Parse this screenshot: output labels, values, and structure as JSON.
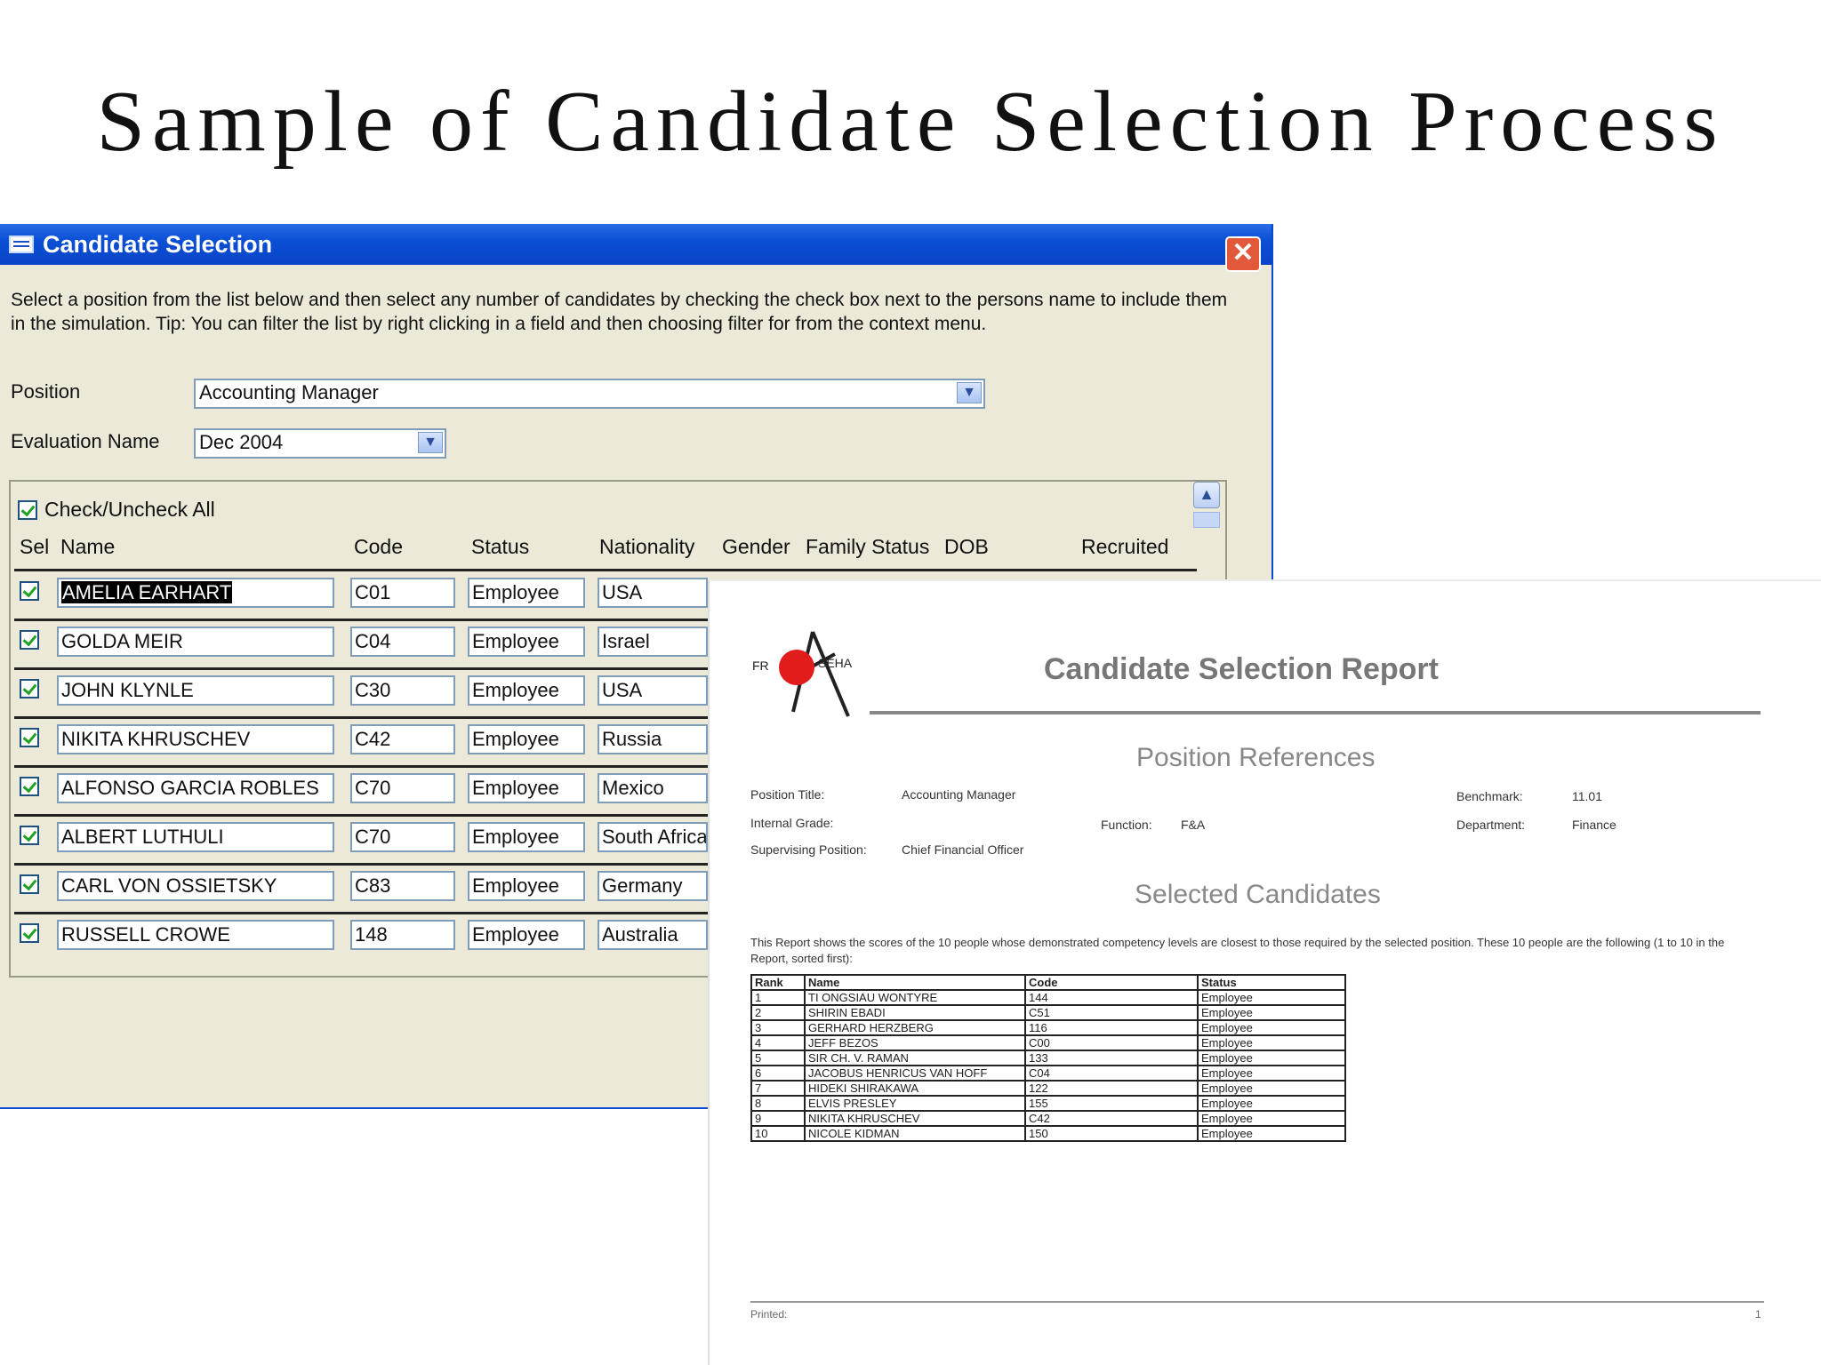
{
  "slide": {
    "title": "Sample of Candidate Selection Process"
  },
  "window": {
    "title": "Candidate Selection",
    "close_symbol": "✕",
    "instructions": "Select a position from the list below and then select any number of candidates by checking the check box next to the persons name to include them in the simulation. Tip: You can filter the list by right clicking in a field and then choosing filter for from the context menu.",
    "position_label": "Position",
    "position_value": "Accounting Manager",
    "evaluation_label": "Evaluation Name",
    "evaluation_value": "Dec 2004",
    "check_all_label": "Check/Uncheck All",
    "columns": [
      "Sel",
      "Name",
      "Code",
      "Status",
      "Nationality",
      "Gender",
      "Family Status",
      "DOB",
      "Recruited"
    ],
    "rows": [
      {
        "name": "AMELIA EARHART",
        "code": "C01",
        "status": "Employee",
        "nationality": "USA",
        "selected": true
      },
      {
        "name": "GOLDA MEIR",
        "code": "C04",
        "status": "Employee",
        "nationality": "Israel",
        "selected": true
      },
      {
        "name": "JOHN KLYNLE",
        "code": "C30",
        "status": "Employee",
        "nationality": "USA",
        "selected": true
      },
      {
        "name": "NIKITA KHRUSCHEV",
        "code": "C42",
        "status": "Employee",
        "nationality": "Russia",
        "selected": true
      },
      {
        "name": "ALFONSO GARCIA ROBLES",
        "code": "C70",
        "status": "Employee",
        "nationality": "Mexico",
        "selected": true
      },
      {
        "name": "ALBERT LUTHULI",
        "code": "C70",
        "status": "Employee",
        "nationality": "South Africa",
        "selected": true
      },
      {
        "name": "CARL VON OSSIETSKY",
        "code": "C83",
        "status": "Employee",
        "nationality": "Germany",
        "selected": true
      },
      {
        "name": "RUSSELL CROWE",
        "code": "148",
        "status": "Employee",
        "nationality": "Australia",
        "selected": true
      }
    ],
    "icons": {
      "app": "form-icon",
      "close": "close-icon",
      "dropdown": "chevron-down-icon",
      "scroll_up": "chevron-up-icon"
    }
  },
  "report": {
    "logo_text_left": "FR",
    "logo_text_right": "SEHA",
    "title": "Candidate Selection Report",
    "section_position": "Position References",
    "fields": {
      "position_title_label": "Position Title:",
      "position_title_value": "Accounting Manager",
      "internal_grade_label": "Internal Grade:",
      "supervising_label": "Supervising Position:",
      "supervising_value": "Chief Financial Officer",
      "function_label": "Function:",
      "function_value": "F&A",
      "benchmark_label": "Benchmark:",
      "benchmark_value": "11.01",
      "department_label": "Department:",
      "department_value": "Finance"
    },
    "section_selected": "Selected Candidates",
    "description": "This Report shows the scores of the 10 people whose demonstrated competency levels are closest to those required by the selected position. These 10 people are the following (1 to 10 in the Report, sorted first):",
    "table_headers": [
      "Rank",
      "Name",
      "Code",
      "Status"
    ],
    "table_rows": [
      [
        "1",
        "TI ONGSIAU WONTYRE",
        "144",
        "Employee"
      ],
      [
        "2",
        "SHIRIN EBADI",
        "C51",
        "Employee"
      ],
      [
        "3",
        "GERHARD HERZBERG",
        "116",
        "Employee"
      ],
      [
        "4",
        "JEFF BEZOS",
        "C00",
        "Employee"
      ],
      [
        "5",
        "SIR CH. V. RAMAN",
        "133",
        "Employee"
      ],
      [
        "6",
        "JACOBUS HENRICUS VAN HOFF",
        "C04",
        "Employee"
      ],
      [
        "7",
        "HIDEKI SHIRAKAWA",
        "122",
        "Employee"
      ],
      [
        "8",
        "ELVIS PRESLEY",
        "155",
        "Employee"
      ],
      [
        "9",
        "NIKITA KHRUSCHEV",
        "C42",
        "Employee"
      ],
      [
        "10",
        "NICOLE KIDMAN",
        "150",
        "Employee"
      ]
    ],
    "footer_left": "Printed:",
    "footer_right": "1"
  }
}
